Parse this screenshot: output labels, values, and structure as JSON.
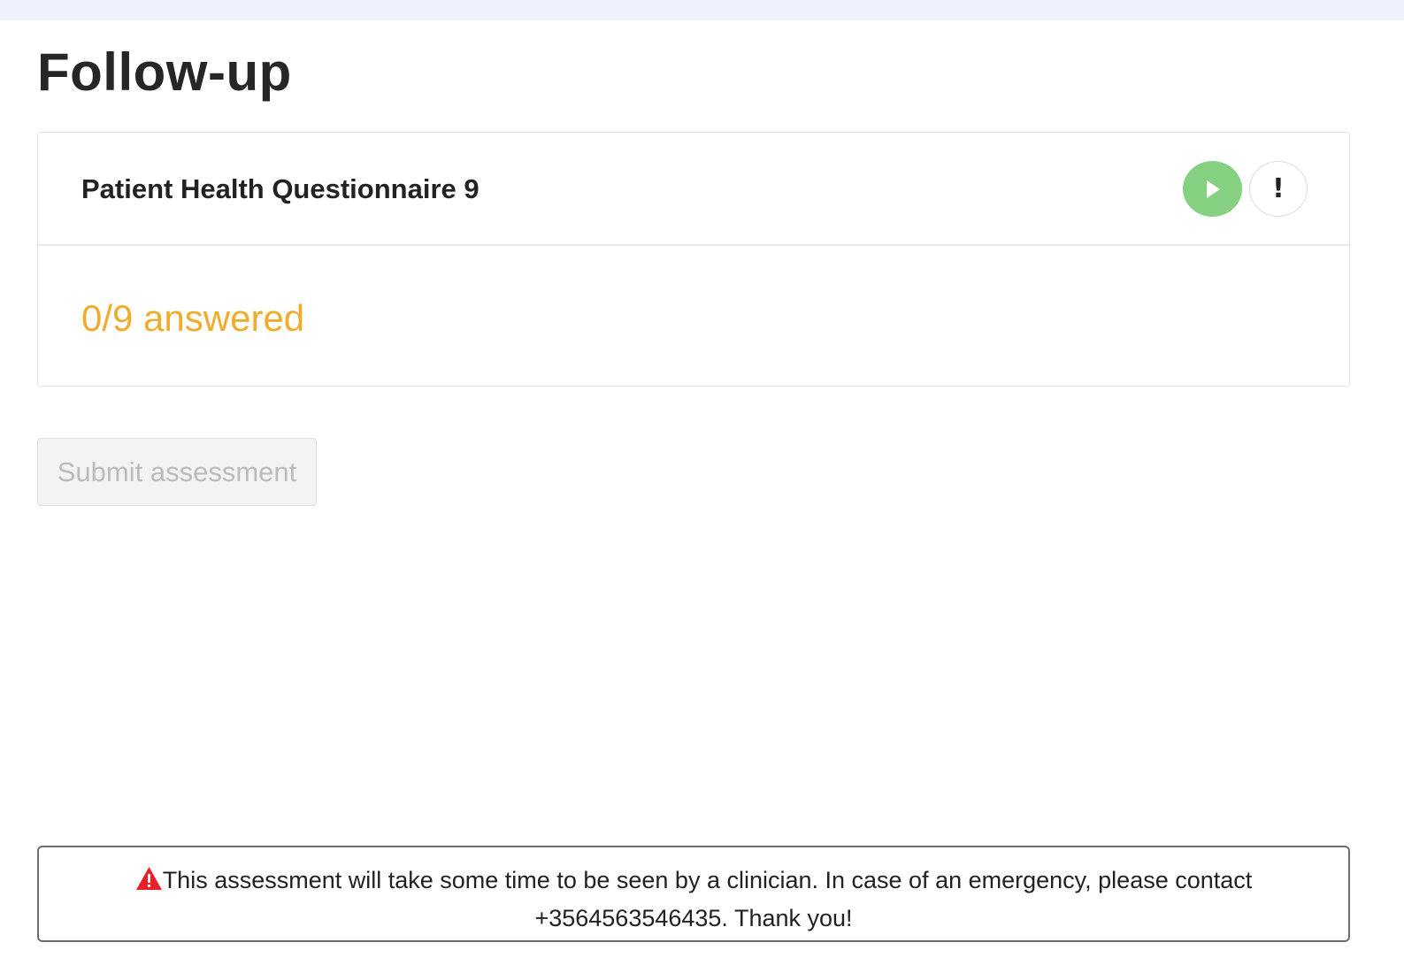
{
  "page": {
    "title": "Follow-up"
  },
  "questionnaire": {
    "title": "Patient Health Questionnaire 9",
    "start_icon": "play-icon",
    "info_label": "!",
    "answered": 0,
    "total": 9,
    "progress_text": "0/9 answered",
    "progress_color": "#f0ac2c",
    "start_color": "#86d081"
  },
  "actions": {
    "submit_label": "Submit assessment",
    "submit_disabled": true
  },
  "notice": {
    "icon": "warning-icon",
    "icon_color": "#e8202a",
    "text": "This assessment will take some time to be seen by a clinician. In case of an emergency, please contact +3564563546435. Thank you!"
  }
}
